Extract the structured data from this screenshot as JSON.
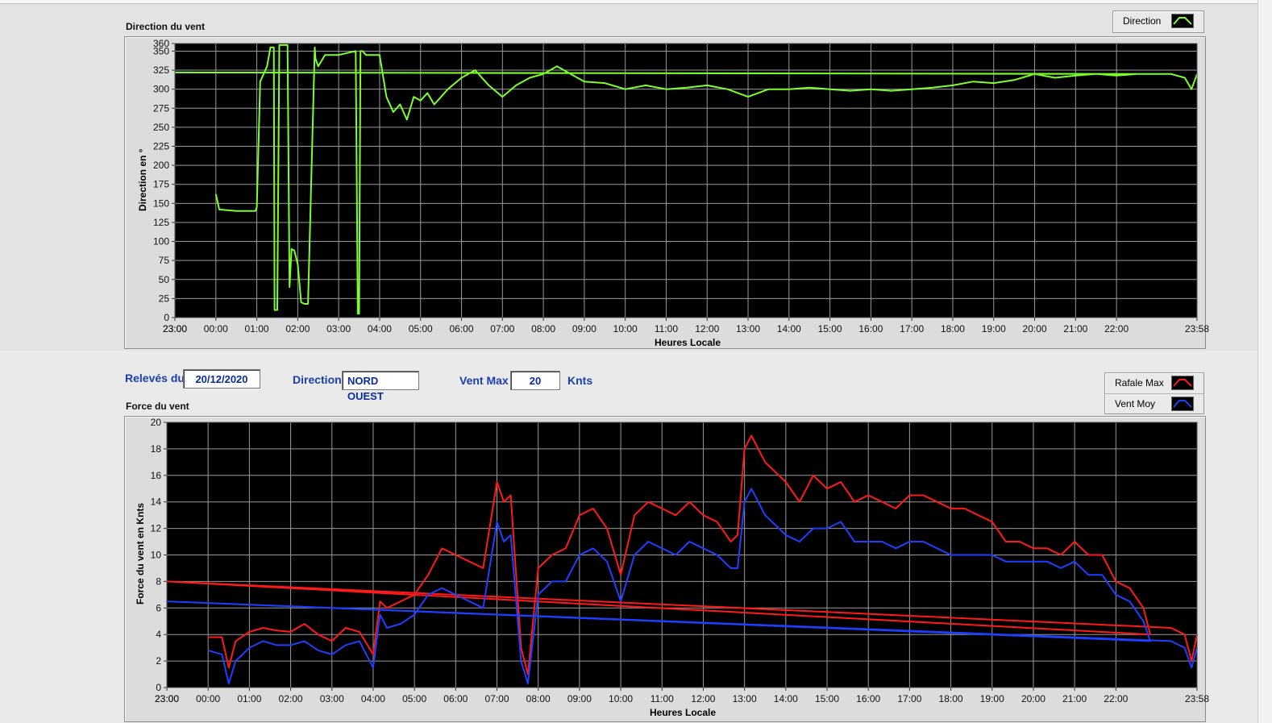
{
  "top": {
    "title": "Direction du vent",
    "ylabel": "Direction en °",
    "xlabel": "Heures Locale",
    "legend": [
      {
        "label": "Direction",
        "color": "#7cff2a"
      }
    ]
  },
  "bottom": {
    "title": "Force du vent",
    "ylabel": "Force du vent en Knts",
    "xlabel": "Heures Locale",
    "legend": [
      {
        "label": "Rafale Max",
        "color": "#ff1a1a"
      },
      {
        "label": "Vent Moy",
        "color": "#1f3fff"
      }
    ]
  },
  "fields": {
    "releves_label": "Relevés du",
    "releves_value": "20/12/2020",
    "direction_label": "Direction",
    "direction_value": "NORD OUEST",
    "ventmax_label": "Vent Max",
    "ventmax_value": "20",
    "ventmax_unit": "Knts"
  },
  "chart_data": [
    {
      "type": "line",
      "title": "Direction du vent",
      "xlabel": "Heures Locale",
      "ylabel": "Direction en °",
      "x_ticks": [
        "23:00",
        "00:00",
        "01:00",
        "02:00",
        "03:00",
        "04:00",
        "05:00",
        "06:00",
        "07:00",
        "08:00",
        "09:00",
        "10:00",
        "11:00",
        "12:00",
        "13:00",
        "14:00",
        "15:00",
        "16:00",
        "17:00",
        "18:00",
        "19:00",
        "20:00",
        "21:00",
        "22:00",
        "23:00",
        "23:58"
      ],
      "y_ticks": [
        0,
        25,
        50,
        75,
        100,
        125,
        150,
        175,
        200,
        225,
        250,
        275,
        300,
        325,
        350,
        360
      ],
      "ylim": [
        0,
        360
      ],
      "grid": true,
      "legend": "top-right",
      "series": [
        {
          "name": "Direction",
          "color": "#7cff2a",
          "x": [
            "00:00",
            "00:05",
            "00:30",
            "00:58",
            "01:00",
            "01:05",
            "01:15",
            "01:20",
            "01:25",
            "01:26",
            "01:30",
            "01:33",
            "01:36",
            "01:45",
            "01:48",
            "01:51",
            "01:55",
            "02:00",
            "02:05",
            "02:10",
            "02:15",
            "02:25",
            "02:26",
            "02:30",
            "02:40",
            "02:50",
            "03:00",
            "03:15",
            "03:25",
            "03:28",
            "03:30",
            "03:32",
            "03:35",
            "03:40",
            "03:50",
            "04:00",
            "04:10",
            "04:20",
            "04:30",
            "04:40",
            "04:50",
            "05:00",
            "05:10",
            "05:20",
            "05:40",
            "06:00",
            "06:20",
            "06:40",
            "07:00",
            "07:20",
            "07:40",
            "08:00",
            "08:20",
            "08:40",
            "09:00",
            "09:30",
            "10:00",
            "10:30",
            "11:00",
            "11:30",
            "12:00",
            "12:30",
            "13:00",
            "13:30",
            "14:00",
            "14:30",
            "15:00",
            "15:30",
            "16:00",
            "16:30",
            "17:00",
            "17:30",
            "18:00",
            "18:30",
            "19:00",
            "19:30",
            "20:00",
            "20:30",
            "21:00",
            "21:30",
            "22:00",
            "22:30",
            "23:00",
            "23:20",
            "23:40",
            "23:50",
            "23:58"
          ],
          "y": [
            162,
            142,
            140,
            140,
            145,
            310,
            330,
            355,
            355,
            10,
            10,
            358,
            358,
            358,
            40,
            90,
            88,
            70,
            20,
            18,
            18,
            355,
            340,
            330,
            345,
            345,
            345,
            348,
            350,
            5,
            5,
            350,
            350,
            345,
            345,
            345,
            290,
            270,
            280,
            260,
            290,
            285,
            295,
            280,
            300,
            315,
            325,
            305,
            290,
            305,
            315,
            320,
            330,
            320,
            310,
            308,
            300,
            305,
            300,
            302,
            305,
            300,
            290,
            300,
            300,
            302,
            300,
            298,
            300,
            298,
            300,
            302,
            305,
            310,
            308,
            312,
            320,
            315,
            318,
            320,
            318,
            320,
            322,
            320,
            315,
            300,
            320
          ]
        }
      ]
    },
    {
      "type": "line",
      "title": "Force du vent",
      "xlabel": "Heures Locale",
      "ylabel": "Force du vent en Knts",
      "x_ticks": [
        "23:00",
        "00:00",
        "01:00",
        "02:00",
        "03:00",
        "04:00",
        "05:00",
        "06:00",
        "07:00",
        "08:00",
        "09:00",
        "10:00",
        "11:00",
        "12:00",
        "13:00",
        "14:00",
        "15:00",
        "16:00",
        "17:00",
        "18:00",
        "19:00",
        "20:00",
        "21:00",
        "22:00",
        "23:00",
        "23:58"
      ],
      "y_ticks": [
        0,
        2,
        4,
        6,
        8,
        10,
        12,
        14,
        16,
        18,
        20
      ],
      "ylim": [
        0,
        20
      ],
      "grid": true,
      "legend": "top-right",
      "series": [
        {
          "name": "Rafale Max",
          "color": "#ff1a1a",
          "x": [
            "00:00",
            "00:20",
            "00:30",
            "00:40",
            "01:00",
            "01:20",
            "01:40",
            "02:00",
            "02:20",
            "02:40",
            "03:00",
            "03:20",
            "03:40",
            "04:00",
            "04:10",
            "04:20",
            "04:40",
            "05:00",
            "05:20",
            "05:40",
            "06:00",
            "06:20",
            "06:40",
            "07:00",
            "07:10",
            "07:20",
            "07:35",
            "07:45",
            "08:00",
            "08:20",
            "08:40",
            "09:00",
            "09:20",
            "09:40",
            "10:00",
            "10:20",
            "10:40",
            "11:00",
            "11:20",
            "11:40",
            "12:00",
            "12:20",
            "12:40",
            "12:50",
            "13:00",
            "13:10",
            "13:30",
            "13:50",
            "14:00",
            "14:20",
            "14:40",
            "15:00",
            "15:20",
            "15:40",
            "16:00",
            "16:20",
            "16:40",
            "17:00",
            "17:20",
            "17:40",
            "18:00",
            "18:20",
            "18:40",
            "19:00",
            "19:20",
            "19:40",
            "20:00",
            "20:20",
            "20:40",
            "21:00",
            "21:20",
            "21:40",
            "22:00",
            "22:20",
            "22:40",
            "22:50",
            "23:00",
            "23:20",
            "23:40",
            "23:50",
            "23:58"
          ],
          "y": [
            3.8,
            3.8,
            1.5,
            3.5,
            4.2,
            4.5,
            4.3,
            4.2,
            4.8,
            4.0,
            3.5,
            4.5,
            4.2,
            2.5,
            6.5,
            6.0,
            6.5,
            7.0,
            8.5,
            10.5,
            10.0,
            9.5,
            9.0,
            15.5,
            14.0,
            14.5,
            3.0,
            1.0,
            9.0,
            10.0,
            10.5,
            13.0,
            13.5,
            12.0,
            8.5,
            13.0,
            14.0,
            13.5,
            13.0,
            14.0,
            13.0,
            12.5,
            11.0,
            11.5,
            18.0,
            19.0,
            17.0,
            16.0,
            15.5,
            14.0,
            16.0,
            15.0,
            15.5,
            14.0,
            14.5,
            14.0,
            13.5,
            14.5,
            14.5,
            14.0,
            13.5,
            13.5,
            13.0,
            12.5,
            11.0,
            11.0,
            10.5,
            10.5,
            10.0,
            11.0,
            10.0,
            10.0,
            8.0,
            7.5,
            6.0,
            4.0,
            8.0,
            4.5,
            4.0,
            2.0,
            4.0
          ]
        },
        {
          "name": "Vent Moy",
          "color": "#1f3fff",
          "x": [
            "00:00",
            "00:20",
            "00:30",
            "00:40",
            "01:00",
            "01:20",
            "01:40",
            "02:00",
            "02:20",
            "02:40",
            "03:00",
            "03:20",
            "03:40",
            "04:00",
            "04:10",
            "04:20",
            "04:40",
            "05:00",
            "05:20",
            "05:40",
            "06:00",
            "06:20",
            "06:40",
            "07:00",
            "07:10",
            "07:20",
            "07:35",
            "07:45",
            "08:00",
            "08:20",
            "08:40",
            "09:00",
            "09:20",
            "09:40",
            "10:00",
            "10:20",
            "10:40",
            "11:00",
            "11:20",
            "11:40",
            "12:00",
            "12:20",
            "12:40",
            "12:50",
            "13:00",
            "13:10",
            "13:30",
            "13:50",
            "14:00",
            "14:20",
            "14:40",
            "15:00",
            "15:20",
            "15:40",
            "16:00",
            "16:20",
            "16:40",
            "17:00",
            "17:20",
            "17:40",
            "18:00",
            "18:20",
            "18:40",
            "19:00",
            "19:20",
            "19:40",
            "20:00",
            "20:20",
            "20:40",
            "21:00",
            "21:20",
            "21:40",
            "22:00",
            "22:20",
            "22:40",
            "22:50",
            "23:00",
            "23:20",
            "23:40",
            "23:50",
            "23:58"
          ],
          "y": [
            2.8,
            2.5,
            0.3,
            2.0,
            3.0,
            3.5,
            3.2,
            3.2,
            3.5,
            2.8,
            2.5,
            3.2,
            3.5,
            1.5,
            5.5,
            4.5,
            4.8,
            5.5,
            7.0,
            7.5,
            7.0,
            6.5,
            6.0,
            12.5,
            11.0,
            11.5,
            2.0,
            0.3,
            7.0,
            8.0,
            8.0,
            10.0,
            10.5,
            9.5,
            6.5,
            10.0,
            11.0,
            10.5,
            10.0,
            11.0,
            10.5,
            10.0,
            9.0,
            9.0,
            14.0,
            15.0,
            13.0,
            12.0,
            11.5,
            11.0,
            12.0,
            12.0,
            12.5,
            11.0,
            11.0,
            11.0,
            10.5,
            11.0,
            11.0,
            10.5,
            10.0,
            10.0,
            10.0,
            10.0,
            9.5,
            9.5,
            9.5,
            9.5,
            9.0,
            9.5,
            8.5,
            8.5,
            7.0,
            6.5,
            5.0,
            3.5,
            6.5,
            3.5,
            3.0,
            1.5,
            3.0
          ]
        }
      ]
    }
  ]
}
